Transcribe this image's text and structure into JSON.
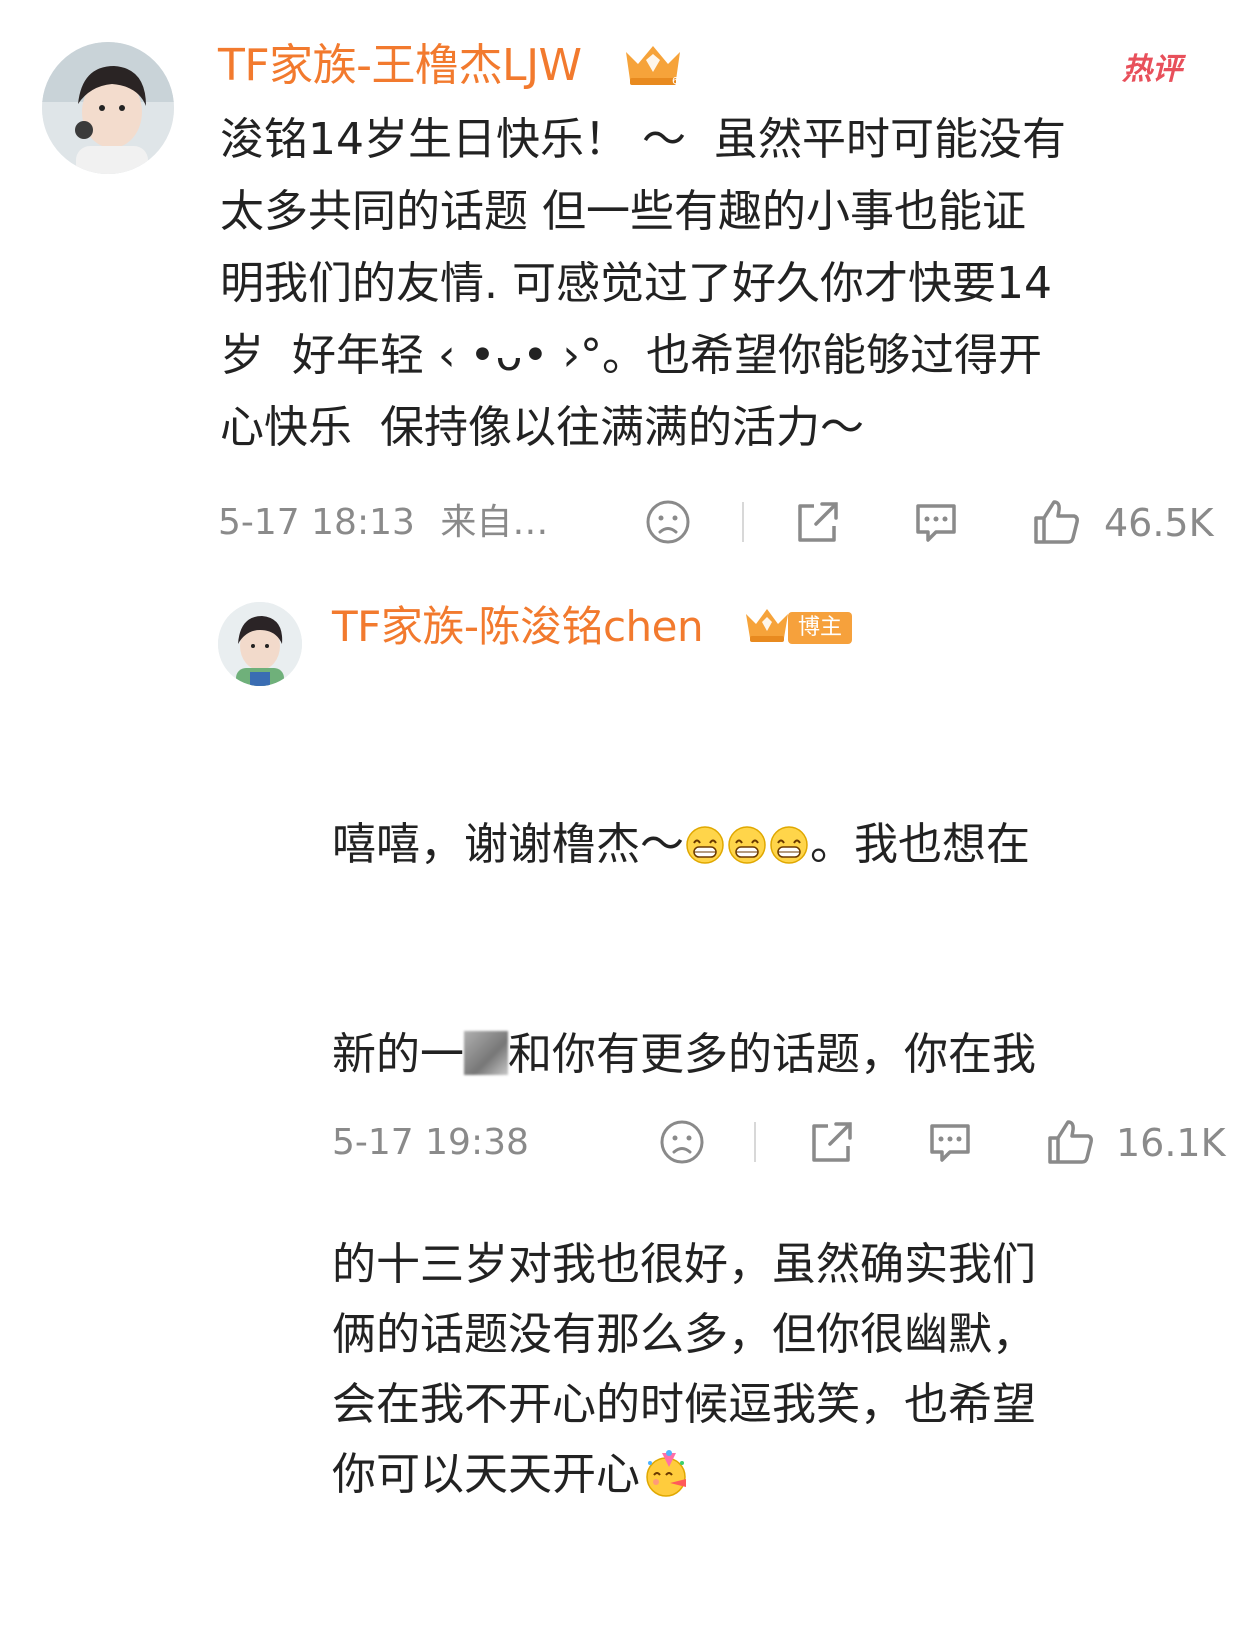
{
  "comment1": {
    "username": "TF家族-王橹杰LJW",
    "hot_label": "热评",
    "text": "浚铭14岁生日快乐！ ～  虽然平时可能没有\n太多共同的话题 但一些有趣的小事也能证\n明我们的友情. 可感觉过了好久你才快要14\n岁  好年轻 ‹ •ᴗ• ›°。也希望你能够过得开\n心快乐  保持像以往满满的活力～",
    "timestamp": "5-17 18:13",
    "source": "来自…",
    "likes": "46.5K"
  },
  "reply1": {
    "username": "TF家族-陈浚铭chen",
    "blogger_label": "博主",
    "text_a": "嘻嘻，谢谢橹杰～",
    "text_b": "。我也想在",
    "text_c": "新的一",
    "text_d": "和你有更多的话题，你在我",
    "text_rest": "的十三岁对我也很好，虽然确实我们\n俩的话题没有那么多，但你很幽默，\n会在我不开心的时候逗我笑，也希望\n你可以天天开心",
    "timestamp": "5-17 19:38",
    "likes": "16.1K"
  },
  "icons": [
    "sad-face-icon",
    "share-icon",
    "comment-icon",
    "thumbs-up-icon",
    "crown-badge-icon",
    "grin-emoji-icon",
    "party-emoji-icon"
  ],
  "colors": {
    "username": "#f27a2e",
    "hot": "#e8505b",
    "meta": "#8a8a8a",
    "blogger": "#f6a13c"
  }
}
